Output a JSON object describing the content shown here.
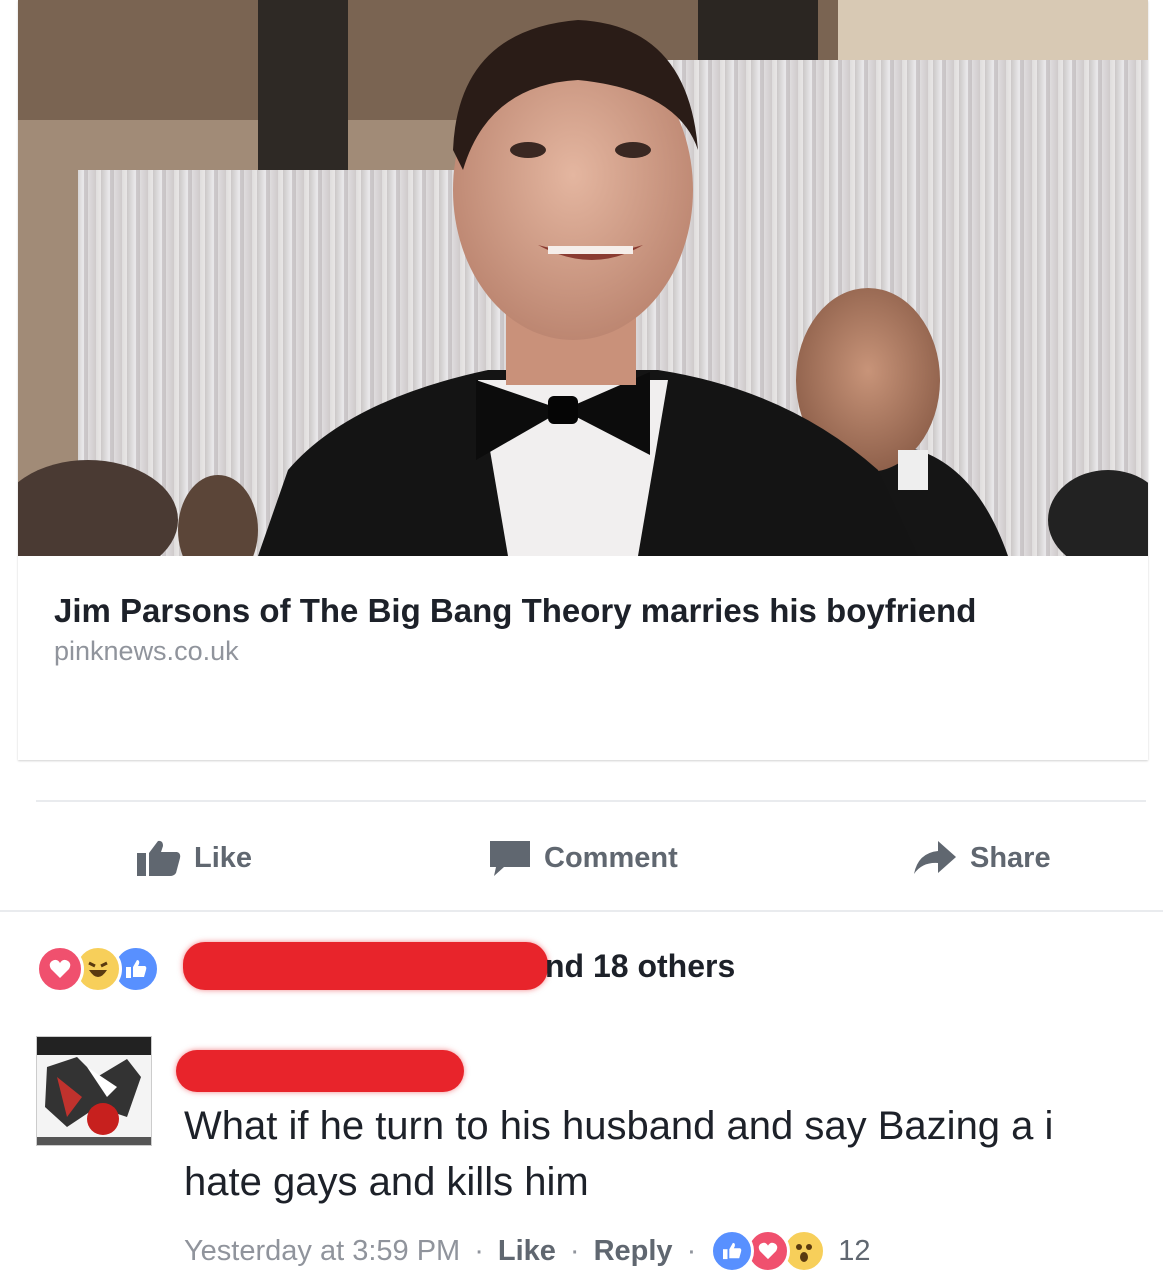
{
  "link_preview": {
    "headline": "Jim Parsons of The Big Bang Theory marries his boyfriend",
    "domain": "pinknews.co.uk"
  },
  "actions": {
    "like_label": "Like",
    "comment_label": "Comment",
    "share_label": "Share"
  },
  "reactions_summary": {
    "icons": [
      "love-icon",
      "haha-icon",
      "like-icon"
    ],
    "others_text": "nd 18 others"
  },
  "comment": {
    "text": "What if he turn to his husband and say Bazing a i hate gays and kills him",
    "timestamp": "Yesterday at 3:59 PM",
    "like_label": "Like",
    "reply_label": "Reply",
    "separator": "·",
    "reaction_icons": [
      "like-icon",
      "love-icon",
      "wow-icon"
    ],
    "reaction_count": "12"
  },
  "colors": {
    "like_blue": "#5890ff",
    "love_red": "#f0506e",
    "haha_yellow": "#f7cf5a",
    "redaction_red": "#e8242b",
    "meta_gray": "#90949c"
  }
}
